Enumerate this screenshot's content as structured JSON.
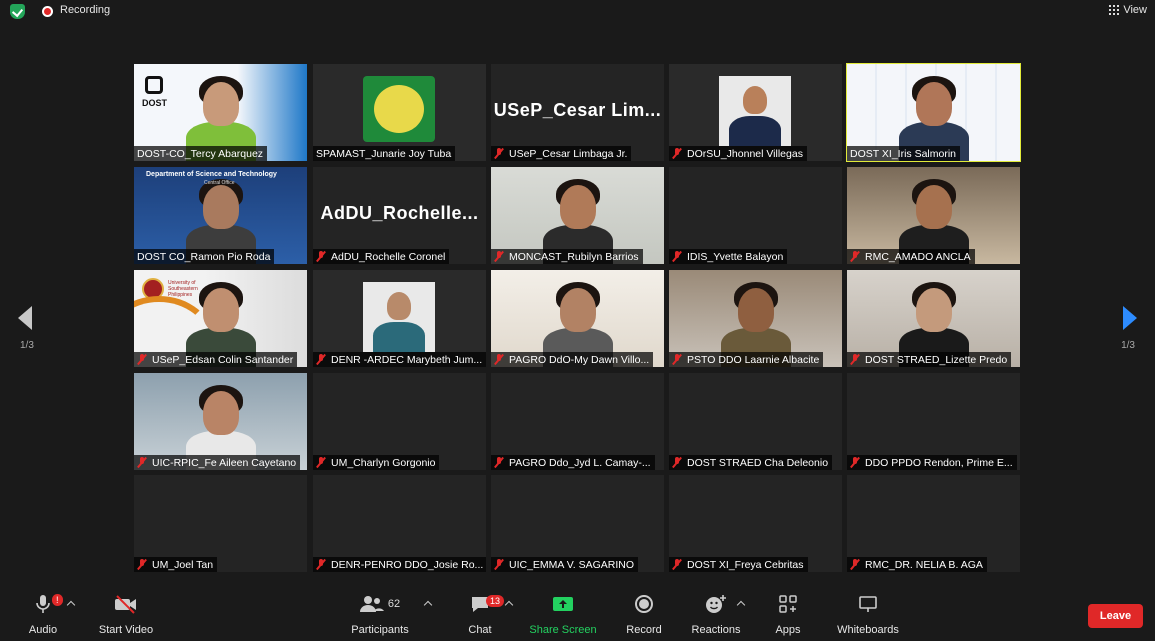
{
  "topbar": {
    "recording_label": "Recording",
    "view_label": "View"
  },
  "pagination": {
    "left": "1/3",
    "right": "1/3"
  },
  "tiles": [
    {
      "name": "DOST-CO_Tercy Abarquez",
      "muted": false,
      "video": true,
      "speaking": false
    },
    {
      "name": "SPAMAST_Junarie Joy Tuba",
      "muted": false,
      "video": true,
      "speaking": false
    },
    {
      "name": "USeP_Cesar Limbaga Jr.",
      "muted": true,
      "video": false,
      "display": "USeP_Cesar  Lim...",
      "speaking": false
    },
    {
      "name": "DOrSU_Jhonnel Villegas",
      "muted": true,
      "video": true,
      "speaking": false
    },
    {
      "name": "DOST XI_Iris Salmorin",
      "muted": false,
      "video": true,
      "speaking": true
    },
    {
      "name": "DOST CO_Ramon Pio Roda",
      "muted": false,
      "video": true,
      "speaking": false
    },
    {
      "name": "AdDU_Rochelle Coronel",
      "muted": true,
      "video": false,
      "display": "AdDU_Rochelle...",
      "speaking": false
    },
    {
      "name": "MONCAST_Rubilyn Barrios",
      "muted": true,
      "video": true,
      "speaking": false
    },
    {
      "name": "IDIS_Yvette Balayon",
      "muted": true,
      "video": false,
      "display": "",
      "speaking": false
    },
    {
      "name": "RMC_AMADO ANCLA",
      "muted": true,
      "video": true,
      "speaking": false
    },
    {
      "name": "USeP_Edsan Colin Santander",
      "muted": true,
      "video": true,
      "speaking": false
    },
    {
      "name": "DENR -ARDEC Marybeth Jum...",
      "muted": true,
      "video": true,
      "speaking": false
    },
    {
      "name": "PAGRO DdO-My Dawn Villo...",
      "muted": true,
      "video": true,
      "speaking": false
    },
    {
      "name": "PSTO DDO Laarnie Albacite",
      "muted": true,
      "video": true,
      "speaking": false
    },
    {
      "name": "DOST STRAED_Lizette Predo",
      "muted": true,
      "video": true,
      "speaking": false
    },
    {
      "name": "UIC-RPIC_Fe Aileen Cayetano",
      "muted": true,
      "video": true,
      "speaking": false
    },
    {
      "name": "UM_Charlyn Gorgonio",
      "muted": true,
      "video": false,
      "display": "",
      "speaking": false
    },
    {
      "name": "PAGRO Ddo_Jyd L.  Camay-...",
      "muted": true,
      "video": false,
      "display": "",
      "speaking": false
    },
    {
      "name": "DOST STRAED Cha Deleonio",
      "muted": true,
      "video": false,
      "display": "",
      "speaking": false
    },
    {
      "name": "DDO PPDO Rendon, Prime E...",
      "muted": true,
      "video": false,
      "display": "",
      "speaking": false
    },
    {
      "name": "UM_Joel Tan",
      "muted": true,
      "video": false,
      "display": "",
      "speaking": false
    },
    {
      "name": "DENR-PENRO DDO_Josie Ro...",
      "muted": true,
      "video": false,
      "display": "",
      "speaking": false
    },
    {
      "name": "UIC_EMMA V. SAGARINO",
      "muted": true,
      "video": false,
      "display": "",
      "speaking": false
    },
    {
      "name": "DOST XI_Freya Cebritas",
      "muted": true,
      "video": false,
      "display": "",
      "speaking": false
    },
    {
      "name": "RMC_DR. NELIA B. AGA",
      "muted": true,
      "video": false,
      "display": "",
      "speaking": false
    }
  ],
  "video_text": {
    "dost_logo": "DOST",
    "dept_banner": "Department of Science and Technology",
    "dept_sub": "Central Office",
    "usep_logo": "University of Southeastern Philippines"
  },
  "toolbar": {
    "audio": "Audio",
    "audio_badge": "!",
    "start_video": "Start Video",
    "participants": "Participants",
    "participants_count": "62",
    "chat": "Chat",
    "chat_badge": "13",
    "share_screen": "Share Screen",
    "record": "Record",
    "reactions": "Reactions",
    "apps": "Apps",
    "whiteboards": "Whiteboards",
    "leave": "Leave"
  },
  "colors": {
    "accent": "#2d8cff",
    "share_green": "#23d160",
    "leave_red": "#e02828",
    "speaking_outline": "#e2eb3a"
  }
}
